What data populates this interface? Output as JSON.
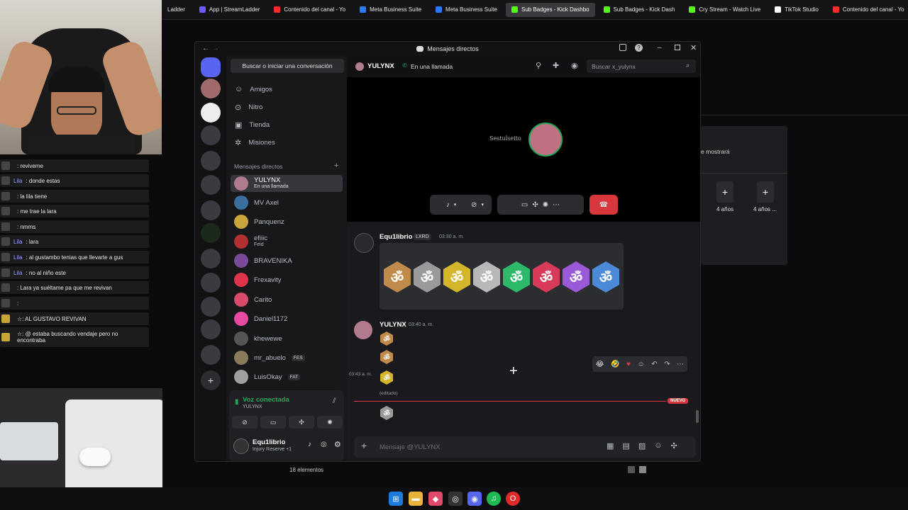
{
  "browser_tabs": [
    {
      "label": "Ladder",
      "color": "#888888"
    },
    {
      "label": "App | StreamLadder",
      "color": "#6b5cff"
    },
    {
      "label": "Contenido del canal - Yo",
      "color": "#ff2a2a"
    },
    {
      "label": "Meta Business Suite",
      "color": "#2a7bff"
    },
    {
      "label": "Meta Business Suite",
      "color": "#2a7bff"
    },
    {
      "label": "Sub Badges - Kick Dashbo",
      "color": "#53fc18",
      "active": true
    },
    {
      "label": "Sub Badges - Kick Dash",
      "color": "#53fc18"
    },
    {
      "label": "Cry Stream - Watch Live",
      "color": "#53fc18"
    },
    {
      "label": "TikTok Studio",
      "color": "#ffffff"
    },
    {
      "label": "Contenido del canal - Yo",
      "color": "#ff2a2a"
    }
  ],
  "stream_chat": [
    {
      "name": "",
      "text": ": reviveme"
    },
    {
      "name": "Lila",
      "text": ": donde estas"
    },
    {
      "name": "",
      "text": ": la lila tiene"
    },
    {
      "name": "",
      "text": ": me trae la lara"
    },
    {
      "name": "",
      "text": ": nmms"
    },
    {
      "name": "Lila",
      "text": ": lara"
    },
    {
      "name": "Lila",
      "text": ": al gustambo tenias que llevarte a gus"
    },
    {
      "name": "Lila",
      "text": ": no al niño este"
    },
    {
      "name": "",
      "text": ": Lara ya suéltame pa que me revivan"
    },
    {
      "name": "",
      "text": ":"
    },
    {
      "name": "",
      "text": "☆: AL GUSTAVO REVIVAN"
    },
    {
      "name": "",
      "text": "☆: @ estaba buscando vendaje pero no encontraba"
    }
  ],
  "window": {
    "title": "Mensajes directos",
    "search_button": "Buscar o iniciar una conversación",
    "nav": [
      {
        "label": "Amigos",
        "icon": "friends-icon"
      },
      {
        "label": "Nitro",
        "icon": "nitro-icon"
      },
      {
        "label": "Tienda",
        "icon": "shop-icon"
      },
      {
        "label": "Misiones",
        "icon": "quests-icon"
      }
    ],
    "dm_header": "Mensajes directos",
    "dms": [
      {
        "name": "YULYNX",
        "sub": "En una llamada",
        "color": "#b07b8e",
        "active": true
      },
      {
        "name": "MV Axel",
        "sub": "",
        "color": "#3b6fa0"
      },
      {
        "name": "Panquenz",
        "sub": "",
        "color": "#c9a43a"
      },
      {
        "name": "efiiic",
        "sub": "Feid",
        "color": "#b23030"
      },
      {
        "name": "BRAVENIKA",
        "sub": "",
        "color": "#7a4a9a"
      },
      {
        "name": "Frexavity",
        "sub": "",
        "color": "#e0344a"
      },
      {
        "name": "Carito",
        "sub": "",
        "color": "#d94b6a"
      },
      {
        "name": "Daniel1172",
        "sub": "",
        "color": "#e84aa0"
      },
      {
        "name": "khewewe",
        "sub": "",
        "color": "#555555"
      },
      {
        "name": "mr_abuelo",
        "sub": "",
        "tag": "FES",
        "color": "#8a7b5a"
      },
      {
        "name": "LuisOkay",
        "sub": "",
        "tag": "FAT",
        "color": "#a0a0a0"
      }
    ],
    "voice": {
      "status": "Voz conectada",
      "channel": "YULYNX"
    },
    "user": {
      "name": "Equ1librio",
      "status": "Injury Reserve +1"
    },
    "chat_header": {
      "name": "YULYNX",
      "status": "En una llamada",
      "search_placeholder": "Buscar x_yulynx"
    },
    "call_name": "Sestulseito",
    "messages": [
      {
        "author": "Equ1librio",
        "tag": "LXRD",
        "time": "03:30 a. m."
      },
      {
        "author": "YULYNX",
        "time": "03:40 a. m.",
        "side_time": "03:43 a. m.",
        "edited": "(editado)"
      }
    ],
    "badge_colors": [
      "#c08a4a",
      "#9a9a9a",
      "#d4b62a",
      "#b8b8b8",
      "#2eb86a",
      "#d83a5a",
      "#9a5ad8",
      "#4a8ad8"
    ],
    "badge_glyph": "ॐ",
    "new_label": "NUEVO",
    "input_placeholder": "Mensaje @YULYNX"
  },
  "behind": {
    "text": "e mostrará",
    "cards": [
      "4 años",
      "4 años ..."
    ],
    "status": "18 elementos"
  }
}
